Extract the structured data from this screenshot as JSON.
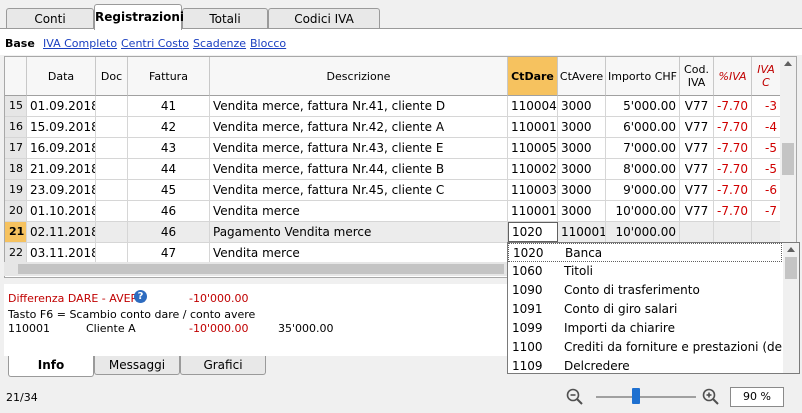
{
  "tabs": [
    "Conti",
    "Registrazioni",
    "Totali",
    "Codici IVA"
  ],
  "views": {
    "base": "Base",
    "links": [
      "IVA Completo",
      "Centri Costo",
      "Scadenze",
      "Blocco"
    ]
  },
  "columns": [
    "Data",
    "Doc",
    "Fattura",
    "Descrizione",
    "CtDare",
    "CtAvere",
    "Importo CHF",
    "Cod. IVA",
    "%IVA",
    "IVA C"
  ],
  "rows": [
    {
      "n": "15",
      "data": "01.09.2018",
      "doc": "",
      "fattura": "41",
      "descr": "Vendita merce, fattura Nr.41, cliente D",
      "dare": "110004",
      "avere": "3000",
      "importo": "5'000.00",
      "cod": "V77",
      "perc": "-7.70",
      "iva": "-3"
    },
    {
      "n": "16",
      "data": "15.09.2018",
      "doc": "",
      "fattura": "42",
      "descr": "Vendita merce, fattura Nr.42, cliente A",
      "dare": "110001",
      "avere": "3000",
      "importo": "6'000.00",
      "cod": "V77",
      "perc": "-7.70",
      "iva": "-4"
    },
    {
      "n": "17",
      "data": "16.09.2018",
      "doc": "",
      "fattura": "43",
      "descr": "Vendita merce, fattura Nr.43, cliente E",
      "dare": "110005",
      "avere": "3000",
      "importo": "7'000.00",
      "cod": "V77",
      "perc": "-7.70",
      "iva": "-5"
    },
    {
      "n": "18",
      "data": "21.09.2018",
      "doc": "",
      "fattura": "44",
      "descr": "Vendita merce, fattura Nr.44, cliente B",
      "dare": "110002",
      "avere": "3000",
      "importo": "8'000.00",
      "cod": "V77",
      "perc": "-7.70",
      "iva": "-5"
    },
    {
      "n": "19",
      "data": "23.09.2018",
      "doc": "",
      "fattura": "45",
      "descr": "Vendita merce, fattura Nr.45, cliente C",
      "dare": "110003",
      "avere": "3000",
      "importo": "9'000.00",
      "cod": "V77",
      "perc": "-7.70",
      "iva": "-6"
    },
    {
      "n": "20",
      "data": "01.10.2018",
      "doc": "",
      "fattura": "46",
      "descr": "Vendita merce",
      "dare": "110001",
      "avere": "3000",
      "importo": "10'000.00",
      "cod": "V77",
      "perc": "-7.70",
      "iva": "-7"
    },
    {
      "n": "21",
      "data": "02.11.2018",
      "doc": "",
      "fattura": "46",
      "descr": "Pagamento Vendita merce",
      "dare": "1020",
      "avere": "110001",
      "importo": "10'000.00",
      "cod": "",
      "perc": "",
      "iva": ""
    },
    {
      "n": "22",
      "data": "03.11.2018",
      "doc": "",
      "fattura": "47",
      "descr": "Vendita merce",
      "dare": "",
      "avere": "",
      "importo": "",
      "cod": "",
      "perc": "",
      "iva": ""
    }
  ],
  "dropdown": [
    {
      "code": "1020",
      "name": "Banca"
    },
    {
      "code": "1060",
      "name": "Titoli"
    },
    {
      "code": "1090",
      "name": "Conto di trasferimento"
    },
    {
      "code": "1091",
      "name": "Conto di giro salari"
    },
    {
      "code": "1099",
      "name": "Importi da chiarire"
    },
    {
      "code": "1100",
      "name": "Crediti da forniture e prestazioni (debitori)"
    },
    {
      "code": "1109",
      "name": "Delcredere"
    }
  ],
  "info": {
    "diff_label": "Differenza DARE - AVERE",
    "diff_value": "-10'000.00",
    "hint": "Tasto F6 = Scambio conto dare / conto avere",
    "acc": "110001",
    "acc_name": "Cliente A",
    "acc_v1": "-10'000.00",
    "acc_v2": "35'000.00"
  },
  "bottom_tabs": [
    "Info",
    "Messaggi",
    "Grafici"
  ],
  "status": {
    "position": "21/34",
    "zoom": "90",
    "zoom_unit": "%"
  },
  "colors": {
    "highlight": "#f6c25f",
    "link": "#1a3fc0",
    "negative": "#d00000"
  }
}
